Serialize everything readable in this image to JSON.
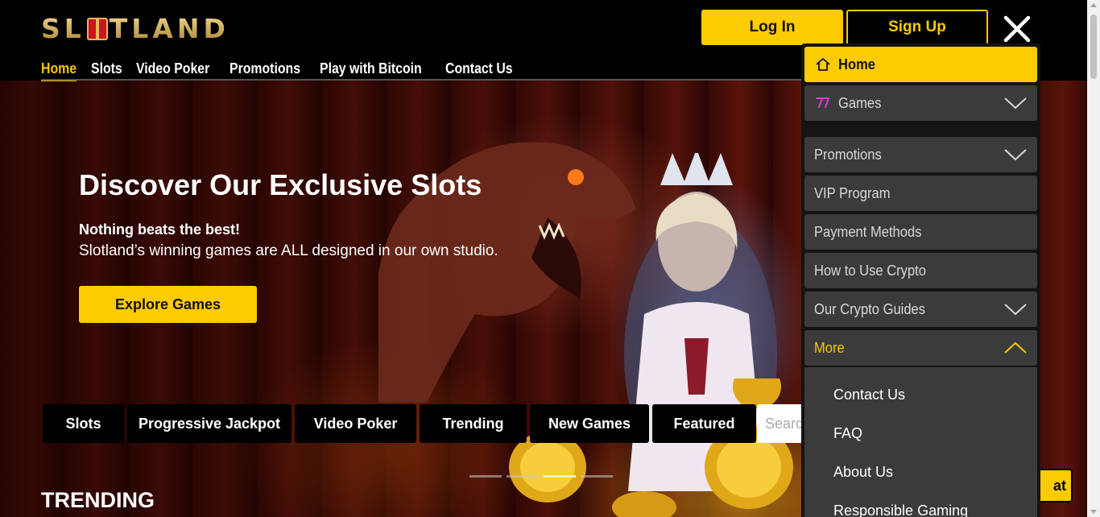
{
  "header": {
    "logo_text": "SL TLAND",
    "login_label": "Log In",
    "signup_label": "Sign Up",
    "nav": [
      {
        "label": "Home",
        "active": true
      },
      {
        "label": "Slots",
        "active": false
      },
      {
        "label": "Video Poker",
        "active": false
      },
      {
        "label": "Promotions",
        "active": false
      },
      {
        "label": "Play with Bitcoin",
        "active": false
      },
      {
        "label": "Contact Us",
        "active": false
      }
    ]
  },
  "hero": {
    "title": "Discover Our Exclusive Slots",
    "subtitle": "Nothing beats the best!",
    "text": "Slotland’s winning games are ALL designed in our own studio.",
    "button_label": "Explore Games",
    "slides": 4,
    "active_slide": 3
  },
  "categories": {
    "tabs": [
      "Slots",
      "Progressive Jackpot",
      "Video Poker",
      "Trending",
      "New Games",
      "Featured"
    ],
    "search_placeholder": "Search"
  },
  "section_title": "TRENDING",
  "chat_label": "at",
  "menu": {
    "items": [
      {
        "label": "Home",
        "icon": "home-icon",
        "active": true
      },
      {
        "label": "Games",
        "icon": "slot-seven-icon",
        "expandable": true
      },
      {
        "label": "Promotions",
        "expandable": true
      },
      {
        "label": "VIP Program"
      },
      {
        "label": "Payment Methods"
      },
      {
        "label": "How to Use Crypto"
      },
      {
        "label": "Our Crypto Guides",
        "expandable": true
      },
      {
        "label": "More",
        "expanded": true
      }
    ],
    "more_subitems": [
      "Contact Us",
      "FAQ",
      "About Us",
      "Responsible Gaming"
    ]
  },
  "colors": {
    "accent": "#fccb00",
    "menu_bg": "#3b3b3b",
    "header_bg": "#000000"
  }
}
